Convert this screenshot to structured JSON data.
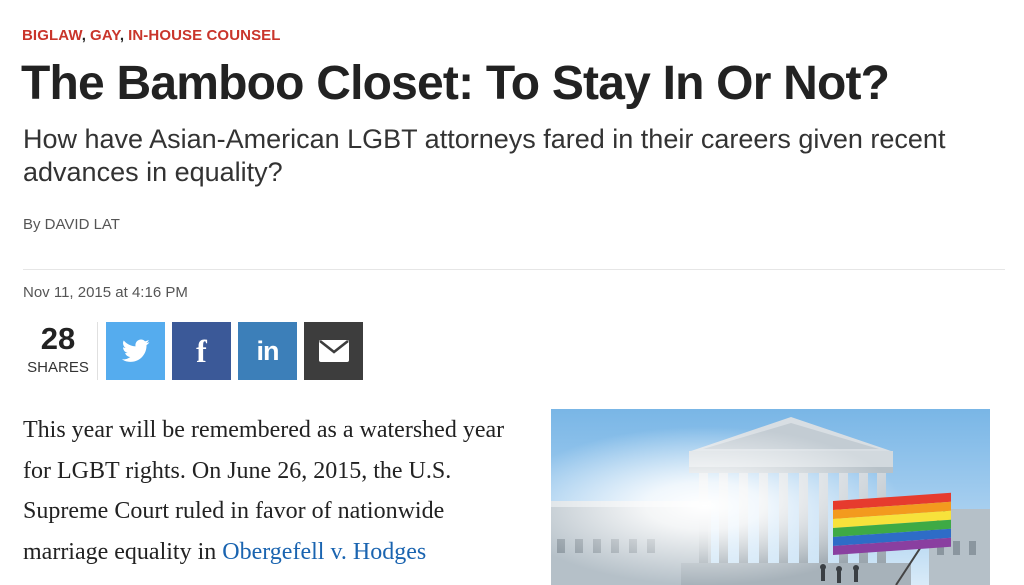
{
  "categories": [
    "BIGLAW",
    "GAY",
    "IN-HOUSE COUNSEL"
  ],
  "separator": ",",
  "article": {
    "title": "The Bamboo Closet: To Stay In Or Not?",
    "subtitle": "How have Asian-American LGBT attorneys fared in their careers given recent advances in equality?",
    "byline": "By DAVID LAT",
    "date": "Nov 11, 2015 at 4:16 PM"
  },
  "shares": {
    "count": "28",
    "label": "SHARES",
    "buttons": [
      {
        "name": "twitter",
        "icon": "twitter-bird-icon",
        "color": "#55acee"
      },
      {
        "name": "facebook",
        "icon": "facebook-f-icon",
        "glyph": "f",
        "color": "#3b5998"
      },
      {
        "name": "linkedin",
        "icon": "linkedin-in-icon",
        "glyph": "in",
        "color": "#3c7fb9"
      },
      {
        "name": "email",
        "icon": "envelope-icon",
        "color": "#3d3d3d"
      }
    ]
  },
  "body": {
    "paragraph_text": "This year will be remembered as a watershed year for LGBT rights. On June 26, 2015, the U.S. Supreme Court ruled in favor of nationwide marriage equality in",
    "link_text": "Obergefell v. Hodges"
  },
  "image": {
    "subject": "U.S. Supreme Court building with rainbow flag"
  },
  "colors": {
    "category": "#c9352b",
    "link": "#1a64b0"
  }
}
